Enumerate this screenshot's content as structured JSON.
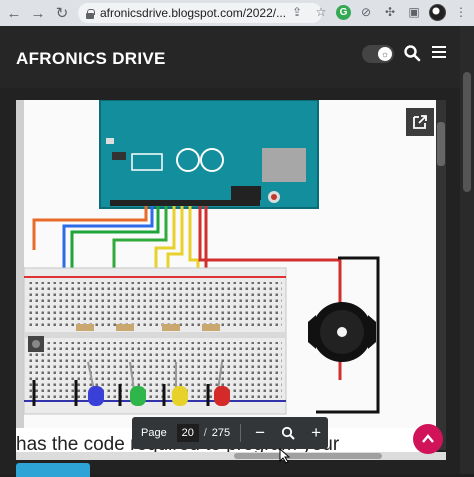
{
  "browser": {
    "url": "afronicsdrive.blogspot.com/2022/...",
    "back_icon": "back-arrow-icon",
    "forward_icon": "forward-arrow-icon",
    "reload_icon": "reload-icon"
  },
  "site": {
    "title": "AFRONICS DRIVE",
    "accent": "#d1145a"
  },
  "viewer": {
    "caption": "has the code required to program your"
  },
  "pdf_toolbar": {
    "page_label": "Page",
    "current_page": "20",
    "separator": "/",
    "total_pages": "275",
    "zoom_out": "−",
    "zoom_in": "+"
  }
}
